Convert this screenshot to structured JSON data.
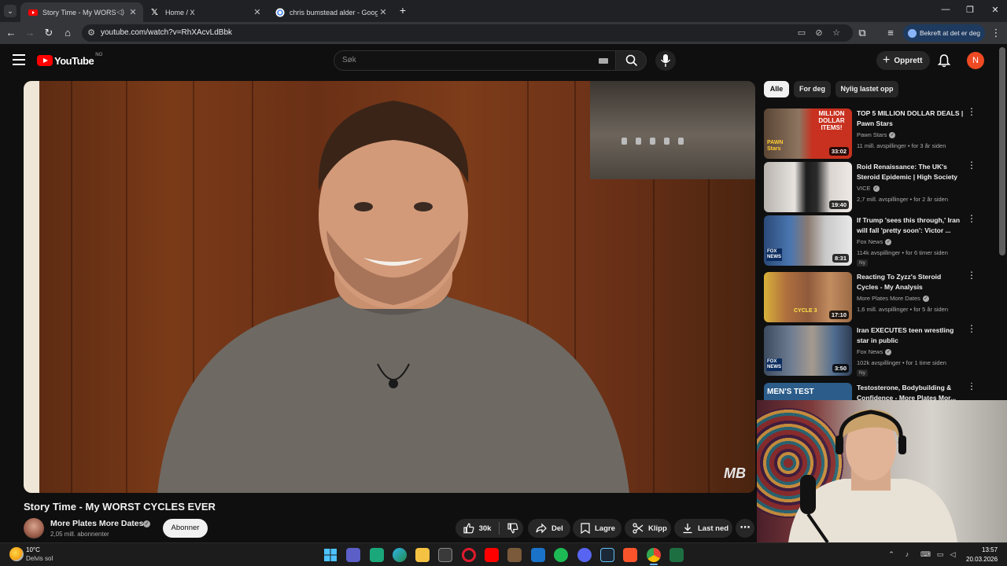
{
  "browser": {
    "tabs": [
      {
        "title": "Story Time - My WORST CY",
        "active": true
      },
      {
        "title": "Home / X",
        "active": false
      },
      {
        "title": "chris bumstead alder - Google",
        "active": false
      }
    ],
    "url": "youtube.com/watch?v=RhXAcvLdBbk",
    "profile_chip": "Bekreft at det er deg"
  },
  "youtube": {
    "logo_text": "YouTube",
    "country_code": "NO",
    "search_placeholder": "Søk",
    "create_label": "Opprett",
    "avatar_letter": "N"
  },
  "video": {
    "title": "Story Time - My WORST CYCLES EVER",
    "channel": "More Plates More Dates",
    "subscribers": "2,05 mill. abonnenter",
    "subscribe_label": "Abonner",
    "likes": "30k",
    "share_label": "Del",
    "save_label": "Lagre",
    "clip_label": "Klipp",
    "download_label": "Last ned",
    "watermark": "MB"
  },
  "filters": [
    "Alle",
    "For deg",
    "Nylig lastet opp"
  ],
  "recommendations": [
    {
      "title": "TOP 5 MILLION DOLLAR DEALS | Pawn Stars",
      "channel": "Pawn Stars",
      "meta": "11 mill. avspillinger • for 3 år siden",
      "duration": "33:02",
      "is_new": false,
      "thumb_color": "#c8311f"
    },
    {
      "title": "Roid Renaissance: The UK's Steroid Epidemic | High Society",
      "channel": "VICE",
      "meta": "2,7 mill. avspillinger • for 2 år siden",
      "duration": "19:40",
      "is_new": false,
      "thumb_color": "#d9d4d0"
    },
    {
      "title": "If Trump 'sees this through,' Iran will fall 'pretty soon': Victor ...",
      "channel": "Fox News",
      "meta": "114k avspillinger • for 6 timer siden",
      "duration": "8:31",
      "is_new": true,
      "thumb_color": "#3f6fa8"
    },
    {
      "title": "Reacting To Zyzz's Steroid Cycles - My Analysis",
      "channel": "More Plates More Dates",
      "meta": "1,6 mill. avspillinger • for 5 år siden",
      "duration": "17:10",
      "is_new": false,
      "thumb_color": "#b0703e"
    },
    {
      "title": "Iran EXECUTES teen wrestling star in public",
      "channel": "Fox News",
      "meta": "102k avspillinger • for 1 time siden",
      "duration": "3:50",
      "is_new": true,
      "thumb_color": "#5a6a82"
    },
    {
      "title": "Testosterone, Bodybuilding & Confidence - More Plates Mor...",
      "channel": "",
      "meta": "",
      "duration": "",
      "is_new": false,
      "thumb_color": "#2c5d8a"
    }
  ],
  "new_badge": "Ny",
  "thumb_texts": {
    "pawn_banner": "MILLION DOLLAR ITEMS!",
    "pawn_logo": "PAWN Stars",
    "fox": "FOX NEWS",
    "cycle": "CYCLE 3",
    "menstest": "MEN'S TEST"
  },
  "taskbar": {
    "temperature": "10°C",
    "condition": "Delvis sol",
    "time": "13:57",
    "date": "20.03.2026"
  }
}
